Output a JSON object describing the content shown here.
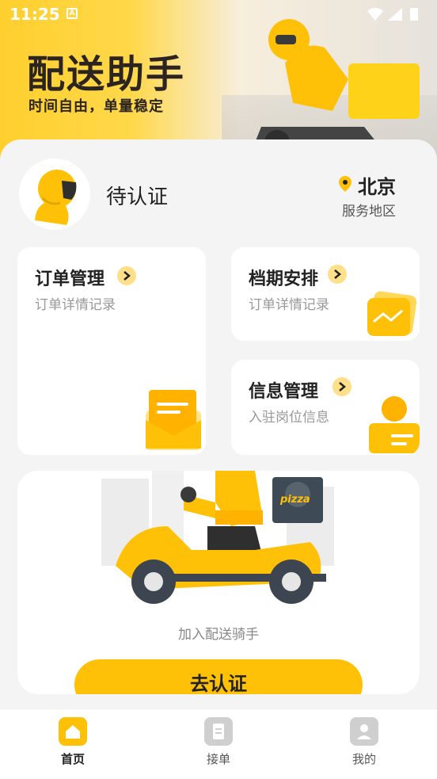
{
  "status_bar": {
    "time": "11:25",
    "notif_glyph": "A"
  },
  "hero": {
    "title": "配送助手",
    "subtitle": "时间自由，单量稳定"
  },
  "profile": {
    "status": "待认证",
    "city": "北京",
    "area_label": "服务地区"
  },
  "cards": {
    "orders": {
      "title": "订单管理",
      "subtitle": "订单详情记录"
    },
    "schedule": {
      "title": "档期安排",
      "subtitle": "订单详情记录"
    },
    "info": {
      "title": "信息管理",
      "subtitle": "入驻岗位信息"
    }
  },
  "join": {
    "label": "加入配送骑手",
    "button": "去认证",
    "box_text": "pizza"
  },
  "nav": [
    {
      "label": "首页",
      "icon": "home-icon"
    },
    {
      "label": "接单",
      "icon": "clipboard-icon"
    },
    {
      "label": "我的",
      "icon": "user-icon"
    }
  ],
  "colors": {
    "accent": "#ffc107",
    "accent_light": "#ffe08a",
    "text": "#222222"
  }
}
